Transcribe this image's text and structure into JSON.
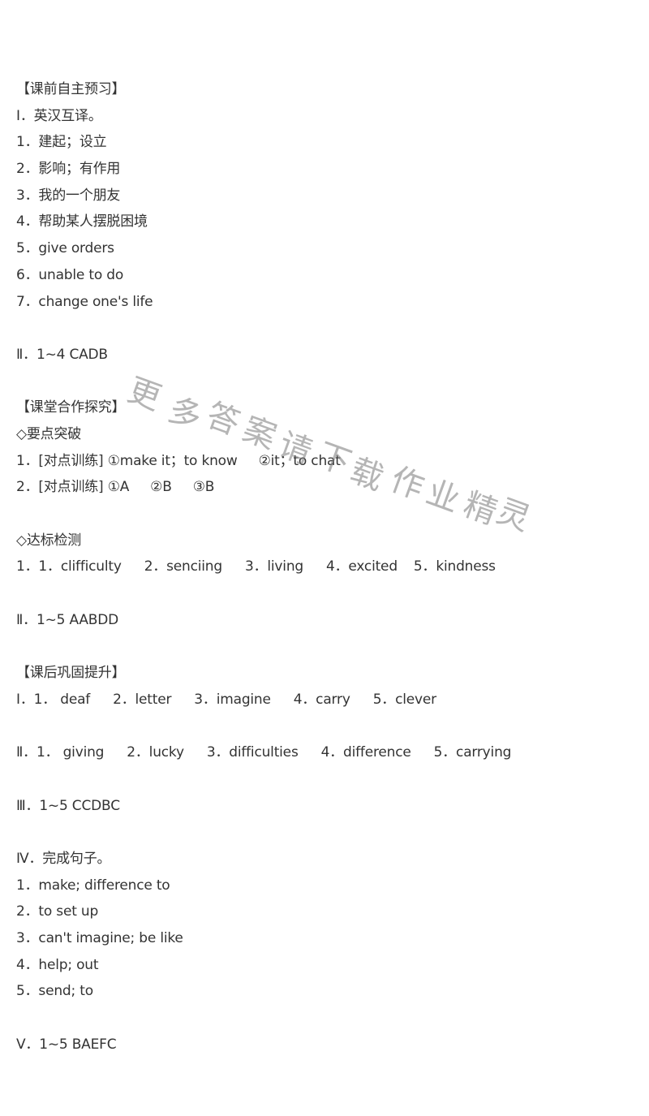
{
  "watermark": {
    "text": "更多答案请下载作业精灵",
    "chars": [
      "更",
      "多",
      "答",
      "案",
      "请",
      "下",
      "载",
      "作",
      "业",
      "精",
      "灵"
    ]
  },
  "sections": {
    "preview": {
      "heading": "【课前自主预习】",
      "part1": {
        "title": "Ⅰ．英汉互译。",
        "items": [
          "1．建起；设立",
          "2．影响；有作用",
          "3．我的一个朋友",
          "4．帮助某人摆脱困境",
          "5．give orders",
          "6．unable to do",
          "7．change one's life"
        ]
      },
      "part2": "Ⅱ．1~4 CADB"
    },
    "classroom": {
      "heading": "【课堂合作探究】",
      "keypoints": {
        "title": "◇要点突破",
        "item1": {
          "prefix": "1．[对点训练] ",
          "a": "①make it；to know",
          "b": "②it；to chat"
        },
        "item2": {
          "prefix": "2．[对点训练] ",
          "a": "①A",
          "b": "②B",
          "c": "③B"
        }
      },
      "check": {
        "title": "◇达标检测",
        "part1": {
          "prefix": "1．",
          "answers": [
            "1．clifficulty",
            "2．senciing",
            "3．living",
            "4．excited",
            "5．kindness"
          ]
        },
        "part2": "Ⅱ．1~5 AABDD"
      }
    },
    "after": {
      "heading": "【课后巩固提升】",
      "part1": {
        "prefix": "Ⅰ．",
        "answers": [
          "1． deaf",
          "2．letter",
          "3．imagine",
          "4．carry",
          "5．clever"
        ]
      },
      "part2": {
        "prefix": "Ⅱ．",
        "answers": [
          "1． giving",
          "2．lucky",
          "3．difficulties",
          "4．difference",
          "5．carrying"
        ]
      },
      "part3": "Ⅲ．1~5 CCDBC",
      "part4": {
        "title": "Ⅳ．完成句子。",
        "items": [
          "1．make; difference to",
          "2．to set up",
          "3．can't imagine; be like",
          "4．help; out",
          "5．send; to"
        ]
      },
      "part5": "Ⅴ．1~5 BAEFC"
    }
  }
}
